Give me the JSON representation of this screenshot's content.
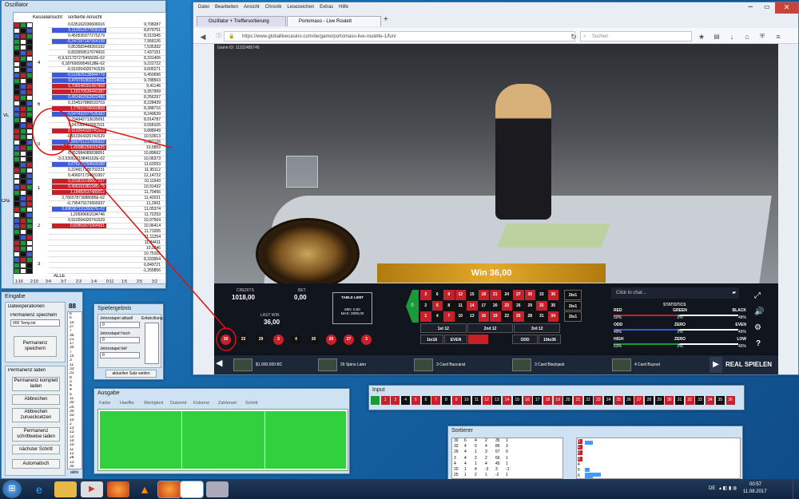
{
  "osz": {
    "title": "Oszillator",
    "col1": "Kesselansicht",
    "col2": "sortierte Ansicht",
    "row_num": "62",
    "row_num2": "31",
    "dozen": [
      "4",
      "6",
      "0",
      "1",
      "2",
      "3"
    ],
    "vals_a": [
      "0,635162030606016",
      "0,112012577836145",
      "0,450535977275279",
      "-0,247287187564199",
      "0,853583448360192",
      "0,832659517074916",
      "-0,9,62170727945602E-02",
      "6,18760099549138E-02",
      "-0,910264320741529",
      "-0,510625138844779",
      "0,470791902214011",
      "0,708548091497968",
      "1,19170536441287",
      "0,491462562822486",
      "0,154537886533703",
      "1,77910706060868",
      "0,547432977535383",
      "0,294942713635091",
      "0,247092433067911",
      "0,910264320741529",
      "-0,910264320741529",
      "0,566751217086932",
      "1,45086256915425",
      "0,452984085838051",
      "-3,0,53062210846162E-02",
      "0,676216794559189",
      "0,224917185702231",
      "0,406071734931957",
      "0,331815146667227",
      "0,406161981345715",
      "1,18482637480012",
      "2,76657873088685E-02",
      "-0,795479173655937",
      "0,69636719126027E-02",
      "1,20599661534746",
      "0,910264320741529",
      "0,82852671064931"
    ],
    "vals_b": [
      "9,708287",
      "8,879751",
      "8,313345",
      "7,958126",
      "7,535392",
      "7,437151",
      "8,331406",
      "9,222722",
      "9,605271",
      "9,450696",
      "9,788563",
      "9,41146",
      "9,357999",
      "8,256297",
      "8,228439",
      "8,388716",
      "8,249639",
      "8,914787",
      "9,558105",
      "9,888049",
      "10,53613",
      "9,982126",
      "10,5859",
      "10,89662",
      "10,06373",
      "11,62053",
      "11,95112",
      "12,14722",
      "10,11943",
      "10,91432",
      "11,70456",
      "11,42021",
      "11,2901",
      "11,05374",
      "11,72253",
      "10,97564",
      "10,96414",
      "11,71005",
      "11,11254",
      "11,84411",
      "10,0346",
      "10,75105",
      "8,333954",
      "6,849721",
      "-1,255856"
    ],
    "alle": "ALLE",
    "bottom": [
      "1:16",
      "2:10",
      "3:4",
      "3:7",
      "2:3",
      "1:4",
      "0:11",
      "1:5",
      "2:5",
      "3:2"
    ],
    "vl": "VL",
    "ora": "Ora"
  },
  "eingabe": {
    "title": "Eingabe",
    "dateiop": "Dateioperationen",
    "count": "88",
    "perm_speichern": "Permanenz speichern",
    "file": "000 Temp.txt",
    "btn_perm": "Permanenz speichern",
    "perm_laden": "Permanenz laden",
    "btn_komplett": "Permanenz komplett laden",
    "btn_abbrechen": "Abbrechen",
    "btn_abbrechen_zurueck": "Abbrechen zurueckcetzen",
    "btn_schritt": "Permanenz schrittweise laden",
    "btn_naechster": "nächster Schritt",
    "btn_auto": "Automatisch",
    "numbers": [
      "6",
      "6",
      "10",
      "27",
      "7",
      "36",
      "21",
      "17",
      "35",
      "7",
      "15",
      "3",
      "11",
      "33",
      "31",
      "8",
      "3",
      "4",
      "4",
      "5",
      "11",
      "30",
      "25",
      "30",
      "33",
      "10",
      "2",
      "13",
      "13",
      "13",
      "10",
      "10",
      "11",
      "12",
      "28",
      "13",
      "30"
    ],
    "aktiv": "aktiv"
  },
  "spieler": {
    "title": "Spielergebnis",
    "jeton_aktuell": "Jetonstapel aktuell",
    "jeton_aktuell_val": "0",
    "entwicklung": "Entwicklung",
    "jeton_hoch": "Jetonstapel hoch",
    "jeton_hoch_val": "0",
    "jeton_tief": "Jetonstapel tief",
    "jeton_tief_val": "0",
    "btn": "aktuellen Satz weiten"
  },
  "ausgabe": {
    "title": "Ausgabe",
    "cols": [
      "Farbe",
      "Haeffte",
      "Wertigkeit",
      "Dutzend",
      "Kolonne",
      "Zahlenart",
      "Schritt"
    ]
  },
  "input": {
    "title": "Input",
    "nums": [
      "1",
      "3",
      "4",
      "5",
      "6",
      "7",
      "8",
      "9",
      "10",
      "11",
      "12",
      "13",
      "14",
      "15",
      "16",
      "17",
      "18",
      "19",
      "20",
      "21",
      "22",
      "23",
      "24",
      "25",
      "26",
      "27",
      "28",
      "29",
      "30",
      "31",
      "32",
      "33",
      "34",
      "35",
      "36"
    ]
  },
  "sortierer": {
    "title": "Sortierer",
    "rows": [
      [
        "30",
        "6",
        "4",
        "2",
        "35",
        "1"
      ],
      [
        "33",
        "4",
        "0",
        "4",
        "86",
        "3"
      ],
      [
        "29",
        "4",
        "1",
        "3",
        "57",
        "0"
      ],
      [
        "3",
        "4",
        "2",
        "2",
        "66",
        "1"
      ],
      [
        "4",
        "4",
        "1",
        "4",
        "45",
        "1"
      ],
      [
        "20",
        "1",
        "4",
        "-3",
        "3",
        "-1"
      ],
      [
        "25",
        "1",
        "2",
        "1",
        "-2",
        "1"
      ]
    ],
    "labels": [
      "0",
      "1",
      "2",
      "3",
      "4",
      "5",
      "6"
    ]
  },
  "browser": {
    "menu": [
      "Datei",
      "Bearbeiten",
      "Ansicht",
      "Chronik",
      "Lesezeichen",
      "Extras",
      "Hilfe"
    ],
    "tab1": "Oszillator + Treffersortierung",
    "tab2": "Portomaso - Live Roulett",
    "plus": "+",
    "url": "https://www.globallivecasino.com/de/game/portomaso-live-roulette-1/fun/",
    "search": "Suchen",
    "game_id": "Game ID: 11102485745"
  },
  "game": {
    "credits_label": "CREDITS",
    "credits": "1018,00",
    "bet_label": "BET",
    "bet": "0,00",
    "lastwin_label": "LAST WIN",
    "lastwin": "36,00",
    "tl_label": "TABLE LIMIT",
    "tl_min": "MIN: 0,00",
    "tl_max": "MAX: 2000,00",
    "win": "Win 36,00",
    "chat": "Click to chat...",
    "grid": [
      [
        "3",
        "6",
        "9",
        "12",
        "15",
        "18",
        "21",
        "24",
        "27",
        "30",
        "33",
        "36"
      ],
      [
        "2",
        "5",
        "8",
        "11",
        "14",
        "17",
        "20",
        "23",
        "26",
        "29",
        "32",
        "35"
      ],
      [
        "1",
        "4",
        "7",
        "10",
        "13",
        "16",
        "19",
        "22",
        "25",
        "28",
        "31",
        "34"
      ]
    ],
    "grid_colors": [
      [
        "r",
        "b",
        "r",
        "r",
        "b",
        "r",
        "r",
        "b",
        "r",
        "r",
        "b",
        "r"
      ],
      [
        "b",
        "r",
        "b",
        "b",
        "r",
        "b",
        "b",
        "r",
        "b",
        "b",
        "r",
        "b"
      ],
      [
        "r",
        "b",
        "r",
        "b",
        "b",
        "r",
        "r",
        "b",
        "r",
        "b",
        "b",
        "r"
      ]
    ],
    "zero": "0",
    "two_to_one": "2to1",
    "dozens": [
      "1st 12",
      "2nd 12",
      "3rd 12"
    ],
    "outside": [
      "1to18",
      "EVEN",
      "ODD",
      "19to36"
    ],
    "stats_title": "STATISTICS",
    "stats": [
      [
        "RED",
        "GREEN",
        "BLACK"
      ],
      [
        "50%",
        "2%",
        "48%"
      ],
      [
        "ODD",
        "ZERO",
        "EVEN"
      ],
      [
        "49%",
        "2%",
        "49%"
      ],
      [
        "HIGH",
        "ZERO",
        "LOW"
      ],
      [
        "53%",
        "2%",
        "45%"
      ]
    ],
    "history": [
      "30",
      "33",
      "29",
      "3",
      "4",
      "20",
      "25",
      "27",
      "3"
    ],
    "history_colors": [
      "r",
      "b",
      "b",
      "r",
      "b",
      "b",
      "r",
      "r",
      "r"
    ],
    "banner": [
      "$1.000.000 BC",
      "26 Spins Later",
      "3 Card Baccarat",
      "3 Card Blackjack",
      "4 Card Buyout"
    ],
    "real": "REAL SPIELEN"
  },
  "taskbar": {
    "lang": "DE",
    "time": "00:57",
    "date": "11.08.2017"
  },
  "colors": {
    "red": "#c8202a",
    "black": "#111111",
    "green": "#1b9a3a",
    "blue_row": "#3d5bd9"
  }
}
